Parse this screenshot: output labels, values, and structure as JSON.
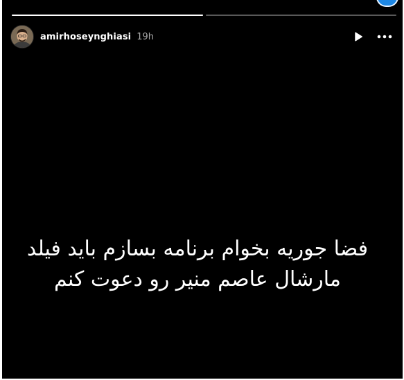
{
  "story": {
    "progress": [
      {
        "state": "done"
      },
      {
        "state": "pending"
      }
    ],
    "user": {
      "username": "amirhoseynghiasi",
      "time": "19h"
    },
    "icons": {
      "avatar": "avatar",
      "play": "play-icon",
      "more": "more-icon",
      "badge": "badge-icon"
    },
    "caption": {
      "line1": "فضا جوریه بخوام برنامه بسازم باید فیلد",
      "line2": "مارشال عاصم منیر رو دعوت کنم"
    },
    "colors": {
      "background": "#000000",
      "text": "#ffffff",
      "muted": "#a8a8a8",
      "badge": "#1e88e5"
    }
  }
}
